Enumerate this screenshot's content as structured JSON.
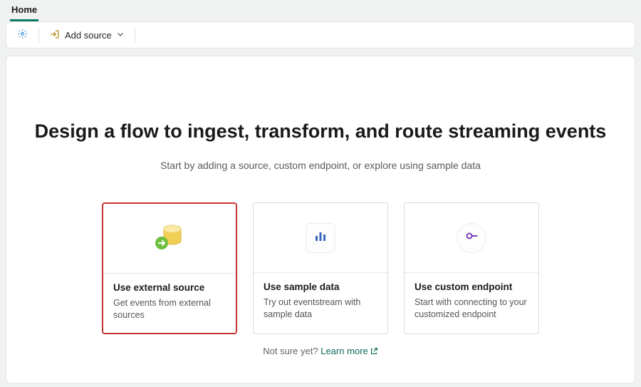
{
  "tabs": {
    "home": "Home"
  },
  "toolbar": {
    "add_source_label": "Add source"
  },
  "hero": {
    "title": "Design a flow to ingest, transform, and route streaming events",
    "subtitle": "Start by adding a source, custom endpoint, or explore using sample data"
  },
  "cards": [
    {
      "title": "Use external source",
      "desc": "Get events from external sources"
    },
    {
      "title": "Use sample data",
      "desc": "Try out eventstream with sample data"
    },
    {
      "title": "Use custom endpoint",
      "desc": "Start with connecting to your customized endpoint"
    }
  ],
  "learn": {
    "prefix": "Not sure yet? ",
    "link": "Learn more"
  }
}
